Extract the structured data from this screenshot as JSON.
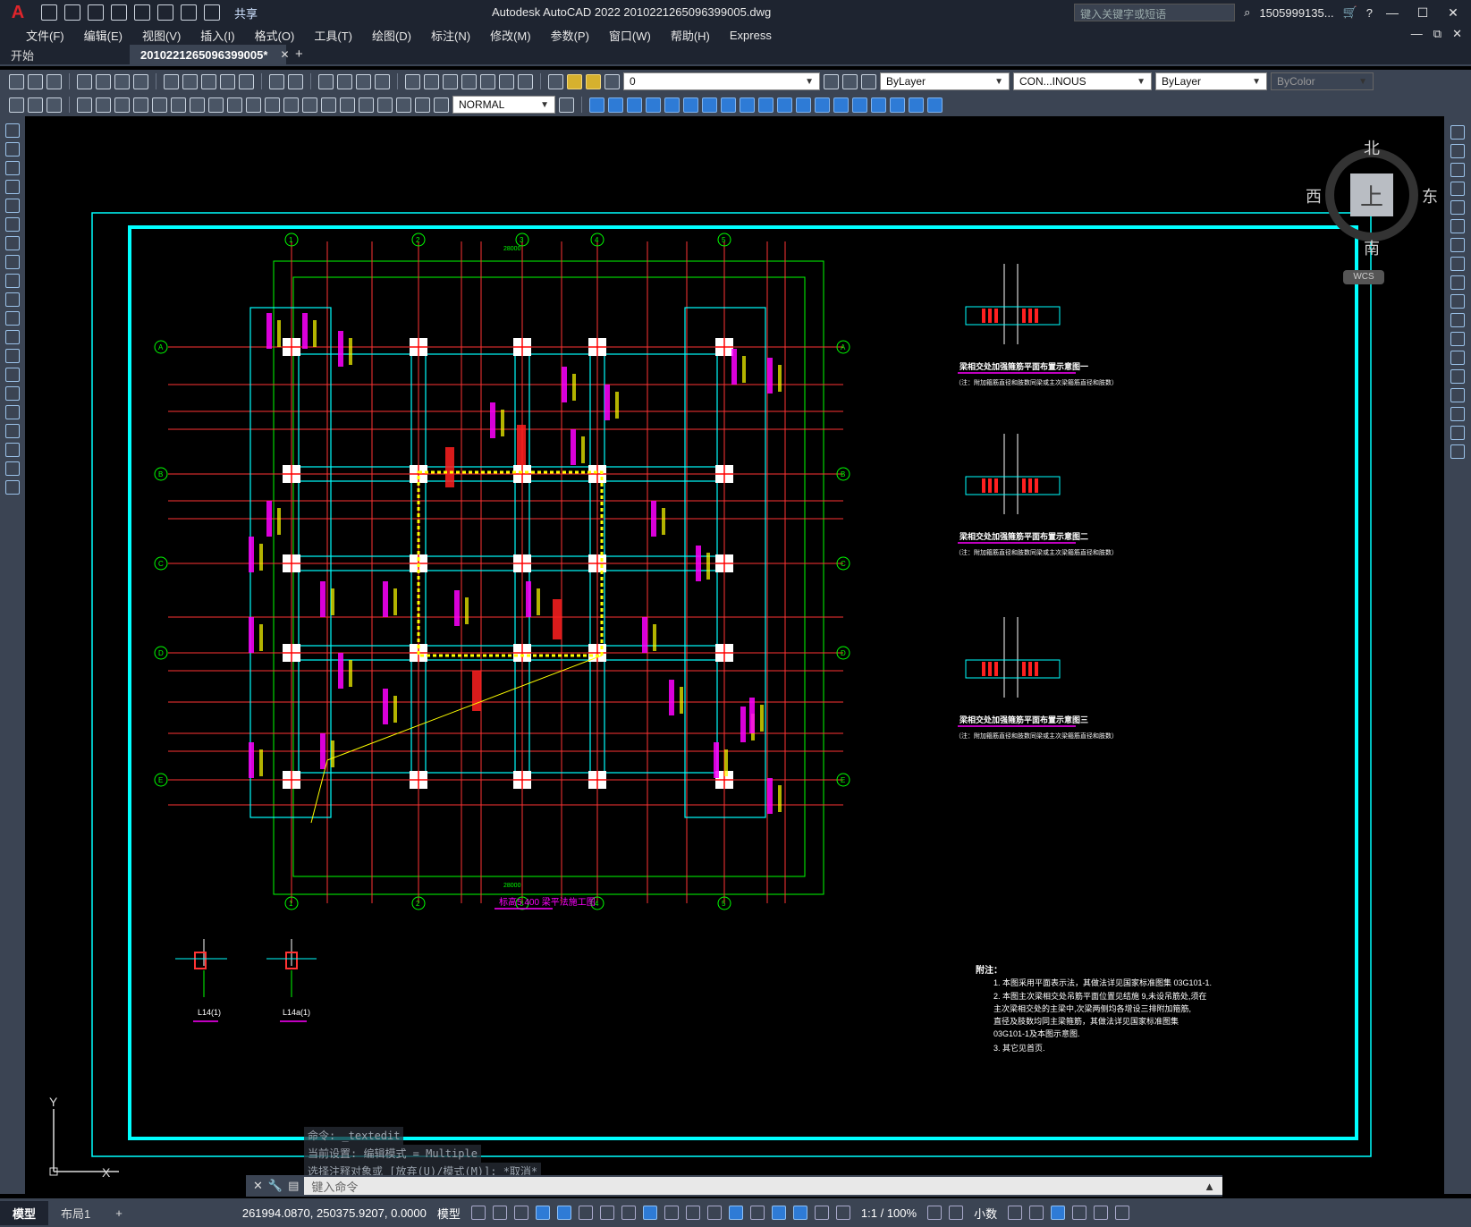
{
  "app": {
    "logo": "A",
    "title": "Autodesk AutoCAD 2022    2010221265096399005.dwg",
    "share_label": "共享",
    "search_placeholder": "键入关键字或短语",
    "user": "1505999135...",
    "minimize": "—",
    "maximize": "☐",
    "close": "✕"
  },
  "menu": [
    "文件(F)",
    "编辑(E)",
    "视图(V)",
    "插入(I)",
    "格式(O)",
    "工具(T)",
    "绘图(D)",
    "标注(N)",
    "修改(M)",
    "参数(P)",
    "窗口(W)",
    "帮助(H)",
    "Express"
  ],
  "menu_right": [
    "—",
    "⧉",
    "✕"
  ],
  "doc_tabs": [
    {
      "label": "开始",
      "active": false
    },
    {
      "label": "2010221265096399005*",
      "active": true
    }
  ],
  "tab_plus": "+",
  "toolbar": {
    "layer_value": "0",
    "color_value": "ByLayer",
    "linetype_value": "CON...INOUS",
    "lineweight_value": "ByLayer",
    "plotstyle_value": "ByColor",
    "dimstyle_value": "NORMAL"
  },
  "viewcube": {
    "north": "北",
    "south": "南",
    "east": "东",
    "west": "西",
    "top": "上",
    "wcs": "WCS"
  },
  "drawing": {
    "plan_title": "标高5.400 梁平法施工图",
    "detail_titles": [
      "梁相交处加强箍筋平面布置示意图一",
      "梁相交处加强箍筋平面布置示意图二",
      "梁相交处加强箍筋平面布置示意图三"
    ],
    "detail_note": "（注：附加箍筋直径和肢数同梁或主次梁箍筋直径和肢数）",
    "section_labels": [
      "L14(1)",
      "L14a(1)"
    ],
    "axis_top": [
      "1",
      "2",
      "3",
      "4",
      "5"
    ],
    "axis_left": [
      "A",
      "B",
      "C",
      "D",
      "E"
    ],
    "total_dim": "28000",
    "notes_heading": "附注：",
    "notes": [
      "1. 本图采用平面表示法，其做法详见国家标准图集 03G101-1.",
      "2. 本图主次梁相交处吊筋平面位置见结施 9,未设吊筋处,须在",
      "   主次梁相交处的主梁中,次梁两侧均各增设三排附加箍筋,",
      "   直径及肢数均同主梁箍筋，其做法详见国家标准图集",
      "   03G101-1及本图示意图.",
      "3. 其它见首页."
    ],
    "ucs_x": "X",
    "ucs_y": "Y"
  },
  "command": {
    "history": [
      "命令: _textedit",
      "当前设置: 编辑模式 = Multiple",
      "选择注释对象或 [放弃(U)/模式(M)]: *取消*"
    ],
    "placeholder": "键入命令"
  },
  "status": {
    "layout_tabs": [
      {
        "label": "模型",
        "active": true
      },
      {
        "label": "布局1",
        "active": false
      }
    ],
    "add": "+",
    "coords": "261994.0870, 250375.9207, 0.0000",
    "space": "模型",
    "scale": "1:1 / 100%",
    "units": "小数"
  },
  "colors": {
    "cyan": "#00ffff",
    "green": "#00ff00",
    "red": "#ff0000",
    "magenta": "#ff00ff",
    "yellow": "#ffff00",
    "white": "#ffffff"
  }
}
